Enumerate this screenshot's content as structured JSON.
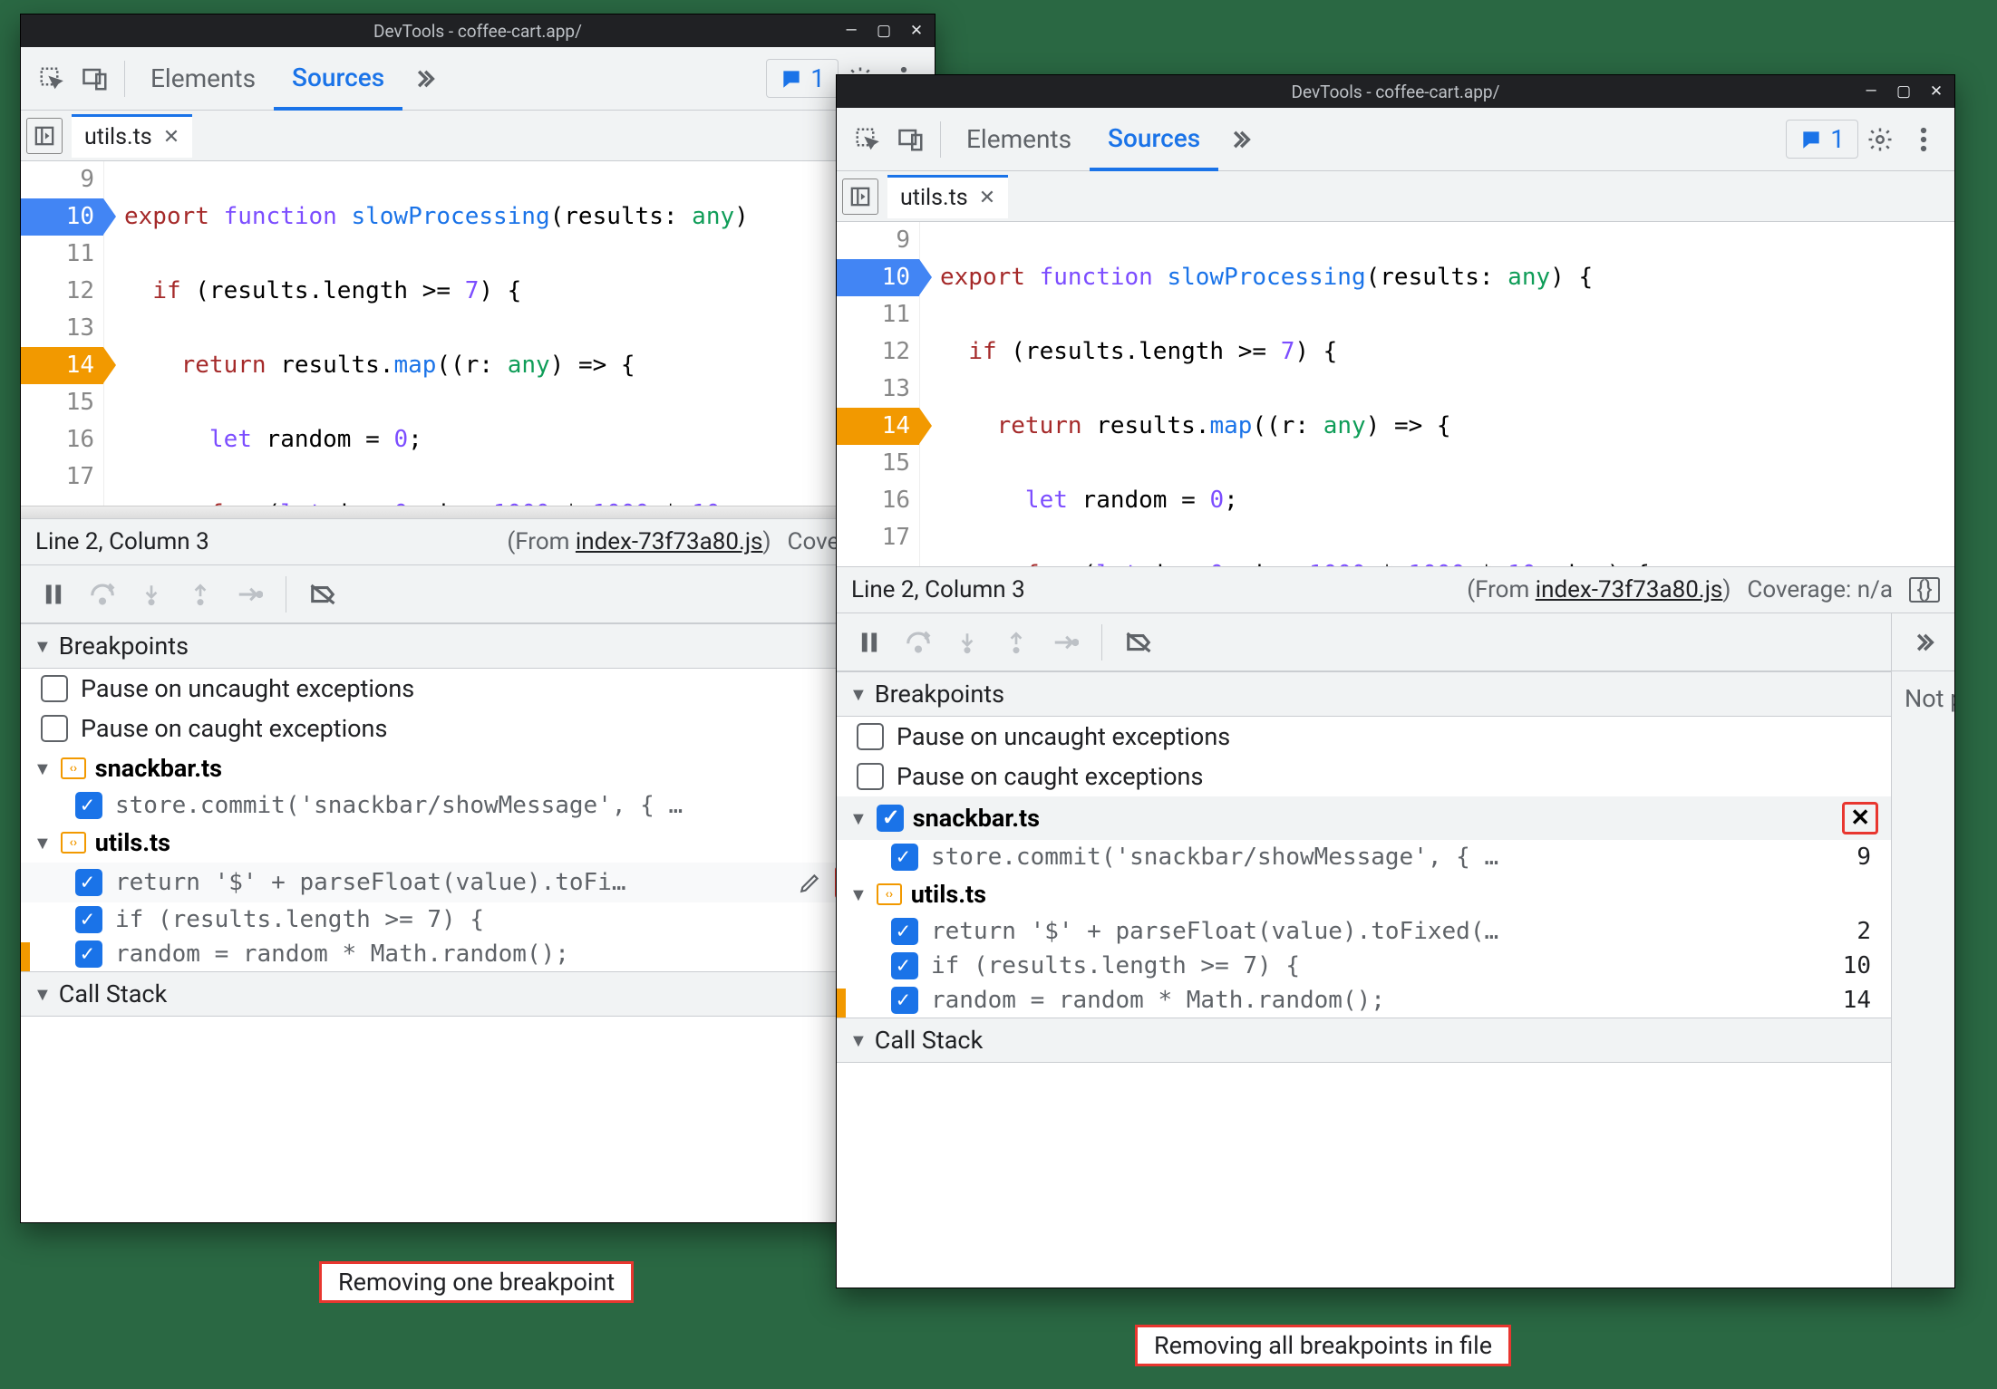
{
  "shared": {
    "title": "DevTools - coffee-cart.app/",
    "tabs": {
      "elements": "Elements",
      "sources": "Sources"
    },
    "issues_count": "1",
    "file_tab": "utils.ts",
    "editor": {
      "lines": [
        "9",
        "10",
        "11",
        "12",
        "13",
        "14",
        "15",
        "16",
        "17"
      ],
      "status_line": "Line 2, Column 3",
      "from_prefix": "(From ",
      "from_link": "index-73f73a80.js",
      "from_suffix": ")",
      "coverage_left": "Coverage: n/",
      "coverage_right": "Coverage: n/a"
    },
    "sections": {
      "breakpoints": "Breakpoints",
      "callstack": "Call Stack",
      "pause_uncaught": "Pause on uncaught exceptions",
      "pause_caught": "Pause on caught exceptions"
    },
    "bp_groups": {
      "snackbar": "snackbar.ts",
      "utils": "utils.ts",
      "snackbar_line": "store.commit('snackbar/showMessage', { …",
      "snackbar_no": "9",
      "utils_l1_left": "return '$' + parseFloat(value).toFi…",
      "utils_l1_right": "return '$' + parseFloat(value).toFixed(…",
      "utils_l1_no": "2",
      "utils_l2": "if (results.length >= 7) {",
      "utils_l2_no": "10",
      "utils_l3": "random = random * Math.random();",
      "utils_l3_no": "14"
    },
    "right_panel_text": "Not pa"
  },
  "captions": {
    "left": "Removing one breakpoint",
    "right": "Removing all breakpoints in file"
  }
}
